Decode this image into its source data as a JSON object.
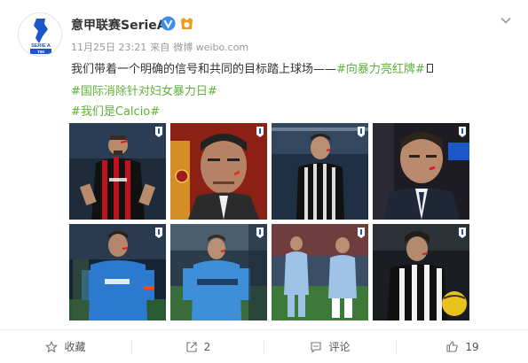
{
  "post": {
    "author": "意甲联赛SerieA",
    "timestamp": "11月25日 23:21",
    "source_prefix": "来自",
    "source": "微博 weibo.com",
    "line1_text": "我们带着一个明确的信号和共同的目标踏上球场——",
    "line1_tag": "#向暴力亮红牌#",
    "line2_tag": "#国际消除针对妇女暴力日#",
    "line3_tag": "#我们是Calcio#",
    "avatar_label": "SERIE A",
    "avatar_sub": "TIM"
  },
  "images": [
    {
      "name": "photo-player-milan-red-mark"
    },
    {
      "name": "photo-coach-roma-red-mark"
    },
    {
      "name": "photo-player-juventus-red-mark"
    },
    {
      "name": "photo-coach-inter-red-mark"
    },
    {
      "name": "photo-player-napoli-red-mark"
    },
    {
      "name": "photo-player-atalanta-red-mark"
    },
    {
      "name": "photo-players-lazio-red-mark"
    },
    {
      "name": "photo-player-udinese-red-mark"
    }
  ],
  "footer": {
    "favorite_label": "收藏",
    "share_count": "2",
    "comment_label": "评论",
    "like_count": "19"
  },
  "colors": {
    "tag": "#5fb03a",
    "brand_blue": "#1a57c8",
    "verified": "#3c8ee8",
    "badge_orange": "#f29a1c"
  },
  "icons": [
    "chevron-down-icon",
    "verified-icon",
    "gold-badge-icon",
    "star-icon",
    "share-icon",
    "comment-icon",
    "like-icon"
  ]
}
